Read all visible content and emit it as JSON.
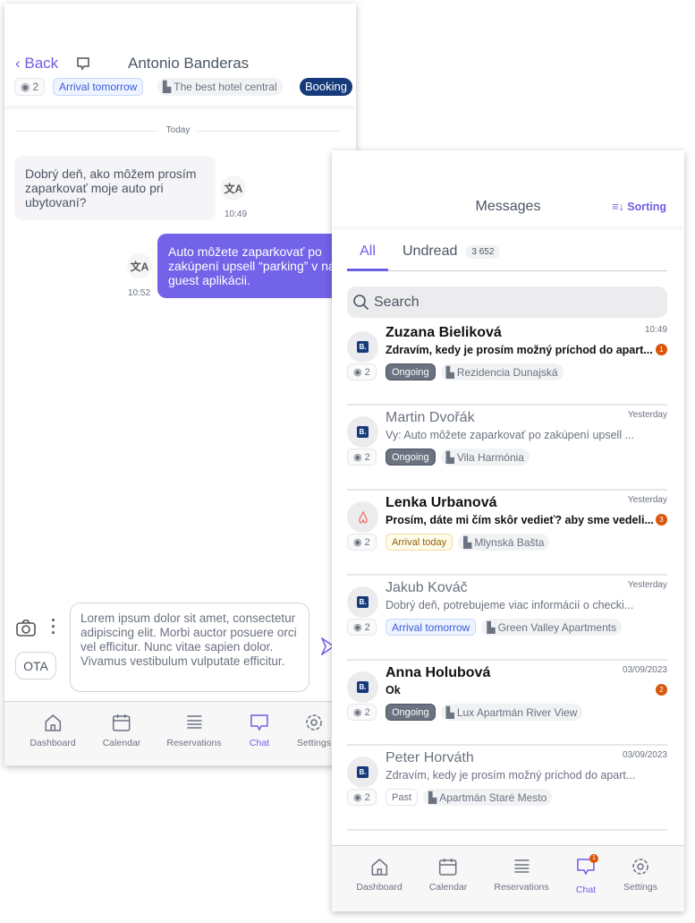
{
  "chat": {
    "back": "Back",
    "guest_name": "Antonio Banderas",
    "guests": "2",
    "arrival": "Arrival tomorrow",
    "hotel": "The best hotel central",
    "channel": "Booking",
    "date_sep": "Today",
    "messages": [
      {
        "text": "Dobrý deň, ako môžem prosím zaparkovať moje auto pri ubytovaní?",
        "time": "10:49",
        "dir": "in"
      },
      {
        "text": "Auto môžete zaparkovať po zakúpení upsell “parking” v našej guest aplikácii.",
        "time": "10:52",
        "dir": "out"
      }
    ],
    "composer_text": "Lorem ipsum dolor sit amet, consectetur adipiscing elit. Morbi auctor posuere orci vel efficitur. Nunc vitae sapien dolor. Vivamus vestibulum vulputate efficitur.",
    "ota": "OTA"
  },
  "nav": [
    "Dashboard",
    "Calendar",
    "Reservations",
    "Chat",
    "Settings"
  ],
  "messages_list": {
    "title": "Messages",
    "sorting": "Sorting",
    "tabs": [
      {
        "label": "All"
      },
      {
        "label": "Undread",
        "count": "3 652"
      }
    ],
    "search_placeholder": "Search",
    "items": [
      {
        "name": "Zuzana Bieliková",
        "preview": "Zdravím, kedy je prosím možný príchod do apart...",
        "time": "10:49",
        "unread": "1",
        "guests": "2",
        "status": "Ongoing",
        "property": "Rezidencia Dunajská",
        "source": "booking"
      },
      {
        "name": "Martin Dvořák",
        "preview": "Vy: Auto môžete zaparkovať po zakúpení upsell ...",
        "time": "Yesterday",
        "guests": "2",
        "status": "Ongoing",
        "property": "Vila Harmónia",
        "source": "booking"
      },
      {
        "name": "Lenka Urbanová",
        "preview": "Prosím, dáte mi čím skôr vedieť? aby sme vedeli...",
        "time": "Yesterday",
        "unread": "3",
        "guests": "2",
        "status": "Arrival today",
        "property": "Mlynská Bašta",
        "source": "airbnb"
      },
      {
        "name": "Jakub Kováč",
        "preview": "Dobrý deň, potrebujeme viac informácií o checki...",
        "time": "Yesterday",
        "guests": "2",
        "status": "Arrival tomorrow",
        "property": "Green Valley Apartments",
        "source": "booking"
      },
      {
        "name": "Anna Holubová",
        "preview": "Ok",
        "time": "03/09/2023",
        "unread": "2",
        "guests": "2",
        "status": "Ongoing",
        "property": "Lux Apartmán River View",
        "source": "booking"
      },
      {
        "name": "Peter Horváth",
        "preview": "Zdravím, kedy je prosím možný príchod do apart...",
        "time": "03/09/2023",
        "guests": "2",
        "status": "Past",
        "property": "Apartmán Staré Mesto",
        "source": "booking"
      }
    ],
    "chat_badge": "1"
  },
  "colors": {
    "accent": "#6d5fe6",
    "booking": "#173a7a",
    "unread": "#d9560b"
  }
}
